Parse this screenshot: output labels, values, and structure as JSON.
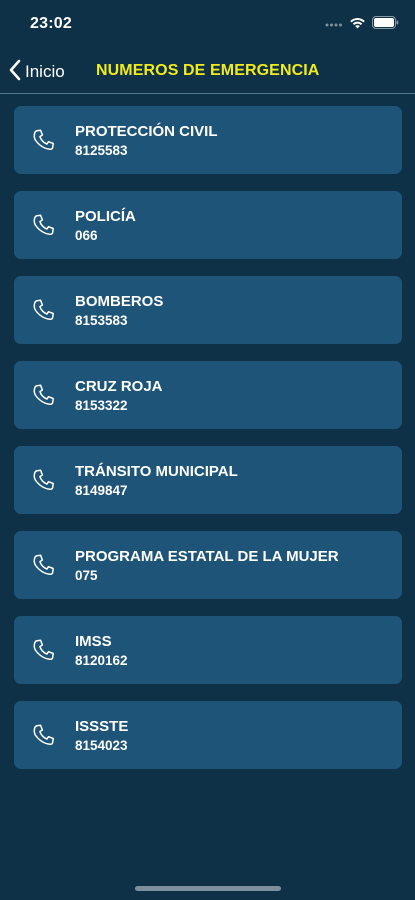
{
  "status_bar": {
    "time": "23:02"
  },
  "nav": {
    "back_label": "Inicio",
    "title": "NUMEROS DE EMERGENCIA"
  },
  "contacts": [
    {
      "name": "PROTECCIÓN CIVIL",
      "number": "8125583",
      "icon": "phone-icon"
    },
    {
      "name": "POLICÍA",
      "number": "066",
      "icon": "phone-icon"
    },
    {
      "name": "BOMBEROS",
      "number": "8153583",
      "icon": "phone-icon"
    },
    {
      "name": "CRUZ ROJA",
      "number": "8153322",
      "icon": "phone-icon"
    },
    {
      "name": "TRÁNSITO MUNICIPAL",
      "number": "8149847",
      "icon": "phone-icon"
    },
    {
      "name": "PROGRAMA ESTATAL DE LA MUJER",
      "number": "075",
      "icon": "phone-icon"
    },
    {
      "name": "IMSS",
      "number": "8120162",
      "icon": "phone-icon"
    },
    {
      "name": "ISSSTE",
      "number": "8154023",
      "icon": "phone-icon"
    }
  ],
  "colors": {
    "background": "#0e3148",
    "card": "#1e5477",
    "title_accent": "#f2eb1c"
  }
}
